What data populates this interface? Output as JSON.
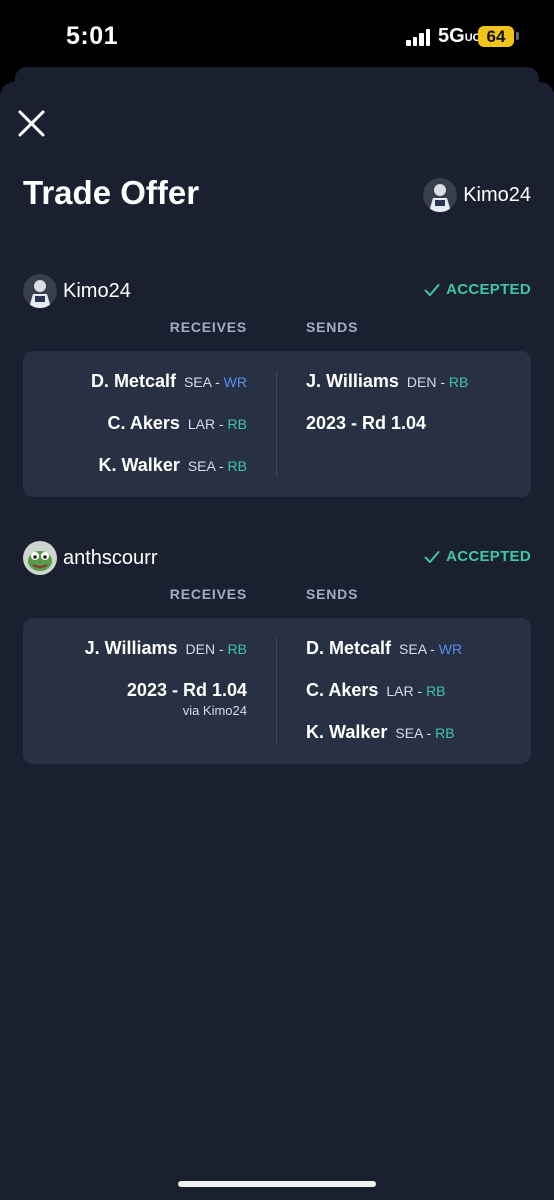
{
  "status_bar": {
    "time": "5:01",
    "network": "5G",
    "network_suffix": "UC",
    "battery": "64"
  },
  "header": {
    "title": "Trade Offer",
    "username": "Kimo24"
  },
  "parties": [
    {
      "username": "Kimo24",
      "status": "ACCEPTED",
      "receives_label": "RECEIVES",
      "sends_label": "SENDS",
      "receives": [
        {
          "name": "D. Metcalf",
          "team": "SEA",
          "sep": " - ",
          "pos": "WR"
        },
        {
          "name": "C. Akers",
          "team": "LAR",
          "sep": " - ",
          "pos": "RB"
        },
        {
          "name": "K. Walker",
          "team": "SEA",
          "sep": " - ",
          "pos": "RB"
        }
      ],
      "sends": [
        {
          "name": "J. Williams",
          "team": "DEN",
          "sep": " - ",
          "pos": "RB"
        },
        {
          "pick": "2023 - Rd 1.04"
        }
      ]
    },
    {
      "username": "anthscourr",
      "status": "ACCEPTED",
      "receives_label": "RECEIVES",
      "sends_label": "SENDS",
      "receives": [
        {
          "name": "J. Williams",
          "team": "DEN",
          "sep": " - ",
          "pos": "RB"
        },
        {
          "pick": "2023 - Rd 1.04",
          "via": "via Kimo24"
        }
      ],
      "sends": [
        {
          "name": "D. Metcalf",
          "team": "SEA",
          "sep": " - ",
          "pos": "WR"
        },
        {
          "name": "C. Akers",
          "team": "LAR",
          "sep": " - ",
          "pos": "RB"
        },
        {
          "name": "K. Walker",
          "team": "SEA",
          "sep": " - ",
          "pos": "RB"
        }
      ]
    }
  ],
  "colors": {
    "background": "#1b2030",
    "card": "#283043",
    "accepted": "#3ec6a8",
    "wr": "#5b8def",
    "rb": "#3ec6a8",
    "label": "#a3acc2"
  },
  "icons": {
    "close": "close-icon",
    "check": "check-icon"
  }
}
